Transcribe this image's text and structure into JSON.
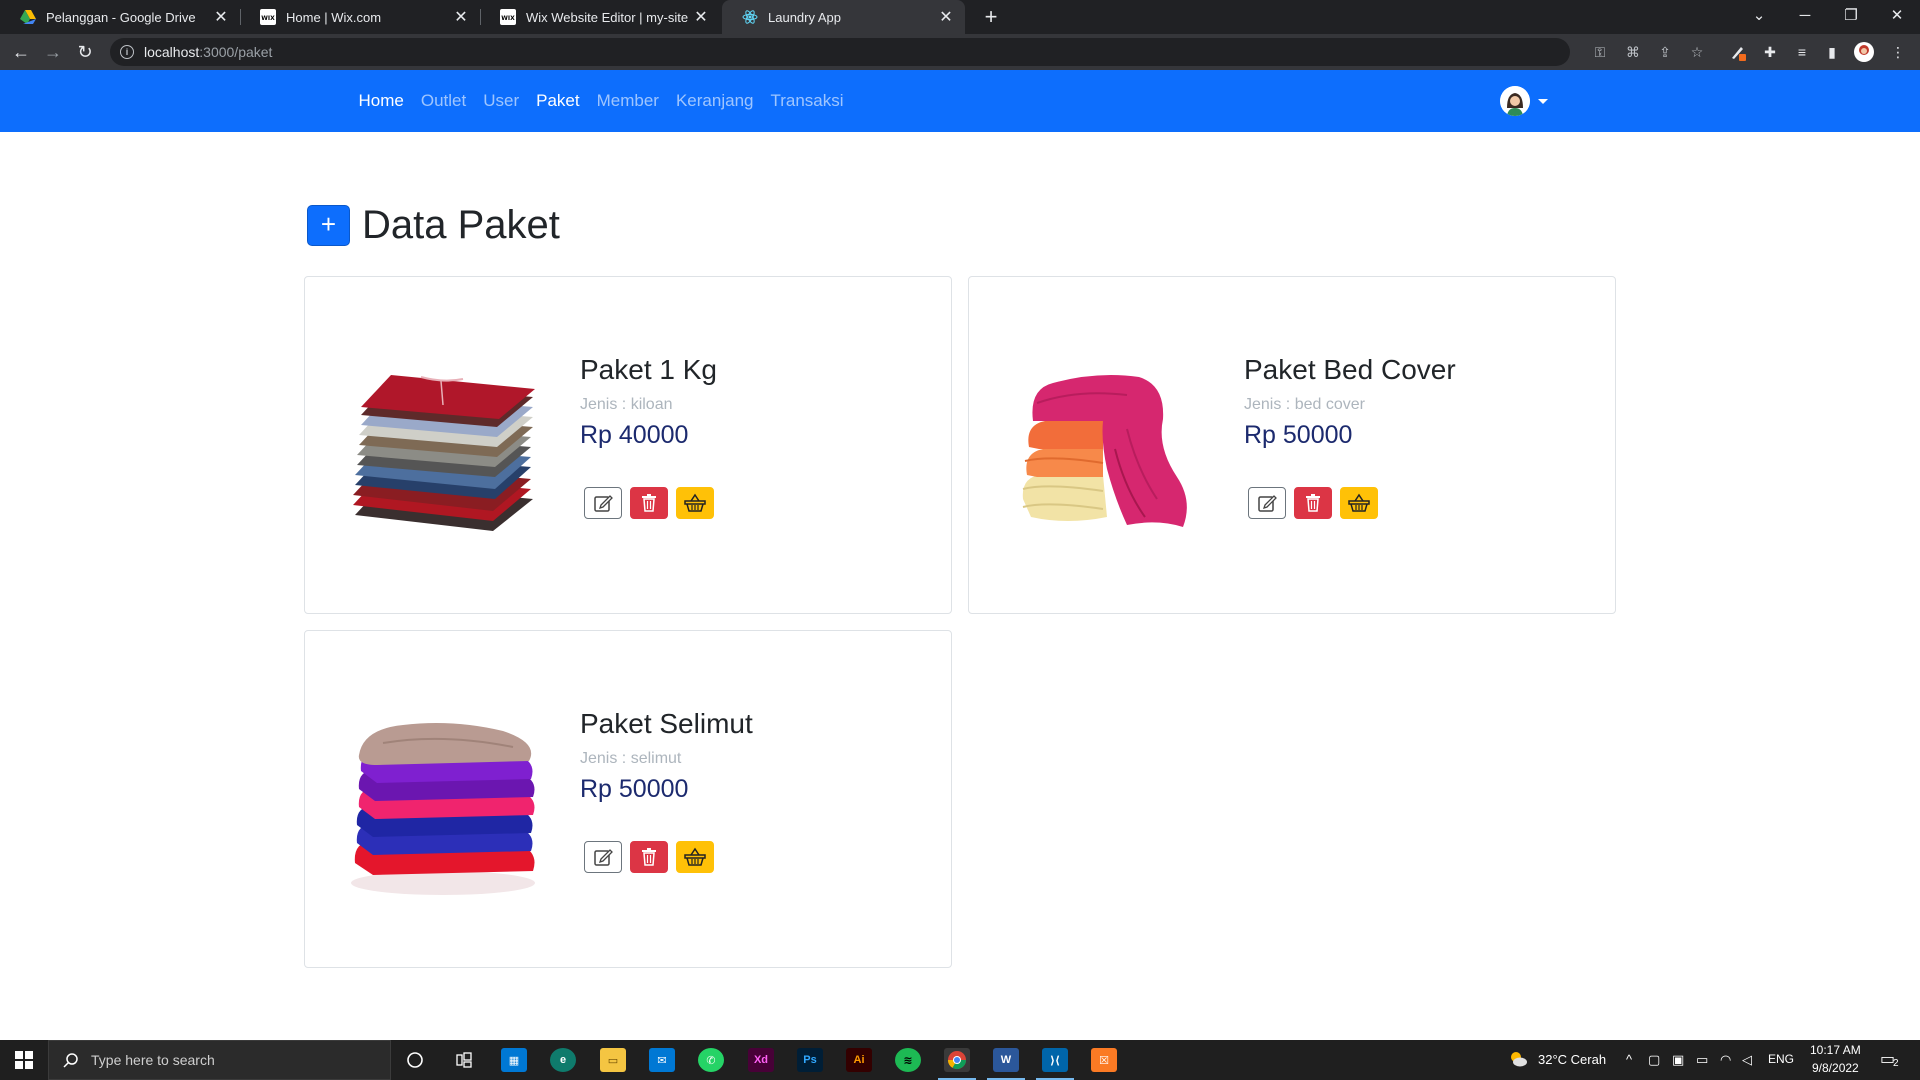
{
  "browser": {
    "tabs": [
      {
        "title": "Pelanggan - Google Drive"
      },
      {
        "title": "Home | Wix.com"
      },
      {
        "title": "Wix Website Editor | my-site"
      },
      {
        "title": "Laundry App"
      }
    ],
    "url_host": "localhost",
    "url_path": ":3000/paket"
  },
  "nav": {
    "links": [
      "Home",
      "Outlet",
      "User",
      "Paket",
      "Member",
      "Keranjang",
      "Transaksi"
    ]
  },
  "page": {
    "title": "Data Paket",
    "add_symbol": "+"
  },
  "cards": [
    {
      "name": "Paket 1 Kg",
      "jenis_label": "Jenis : ",
      "jenis": "kiloan",
      "price": "Rp 40000",
      "image": "folded-shirts"
    },
    {
      "name": "Paket Bed Cover",
      "jenis_label": "Jenis : ",
      "jenis": "bed cover",
      "price": "Rp 50000",
      "image": "folded-blankets"
    },
    {
      "name": "Paket Selimut",
      "jenis_label": "Jenis : ",
      "jenis": "selimut",
      "price": "Rp 50000",
      "image": "folded-towels"
    }
  ],
  "taskbar": {
    "search_placeholder": "Type here to search",
    "weather": "32°C  Cerah",
    "lang": "ENG",
    "time": "10:17 AM",
    "date": "9/8/2022",
    "notif_count": "2"
  },
  "colors": {
    "primary": "#0d6efd",
    "danger": "#dc3545",
    "warning": "#ffc107",
    "price": "#1c2a6e"
  }
}
